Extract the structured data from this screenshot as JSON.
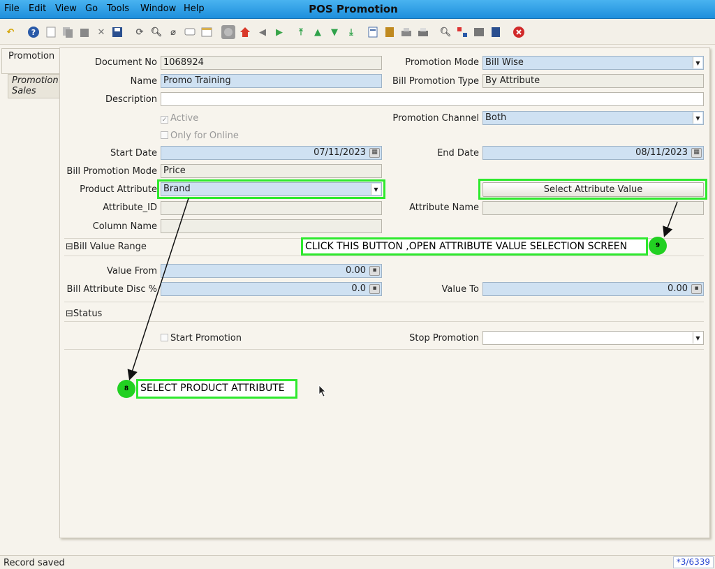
{
  "window": {
    "title": "POS Promotion"
  },
  "menu": [
    {
      "label": "File"
    },
    {
      "label": "Edit"
    },
    {
      "label": "View"
    },
    {
      "label": "Go"
    },
    {
      "label": "Tools"
    },
    {
      "label": "Window"
    },
    {
      "label": "Help"
    }
  ],
  "toolbar": {
    "icons": [
      "undo-icon",
      "help-icon",
      "new-record-icon",
      "copy-record-icon",
      "delete-icon",
      "delete-selection-icon",
      "save-icon",
      "refresh-icon",
      "find-icon",
      "attachment-icon",
      "chat-icon",
      "grid-toggle-icon",
      "history-icon",
      "home-icon",
      "back-icon",
      "forward-icon",
      "first-record-icon",
      "previous-record-icon",
      "next-record-icon",
      "last-record-icon",
      "report-icon",
      "archive-icon",
      "print-preview-icon",
      "print-icon",
      "zoom-across-icon",
      "workflow-icon",
      "product-info-icon",
      "end-icon",
      "close-icon"
    ]
  },
  "tabs": [
    {
      "label": "Promotion",
      "active": true
    },
    {
      "label": "Promotion Sales",
      "active": false
    }
  ],
  "form": {
    "document_no": {
      "label": "Document No",
      "value": "1068924"
    },
    "name": {
      "label": "Name",
      "value": "Promo Training"
    },
    "description": {
      "label": "Description",
      "value": ""
    },
    "active": {
      "label": "Active",
      "checked": true
    },
    "only_online": {
      "label": "Only for Online",
      "checked": false
    },
    "start_date": {
      "label": "Start Date",
      "value": "07/11/2023"
    },
    "bill_promotion_mode": {
      "label": "Bill Promotion Mode",
      "value": "Price"
    },
    "product_attribute": {
      "label": "Product Attribute",
      "value": "Brand"
    },
    "attribute_id": {
      "label": "Attribute_ID",
      "value": ""
    },
    "column_name": {
      "label": "Column Name",
      "value": ""
    },
    "promotion_mode": {
      "label": "Promotion Mode",
      "value": "Bill Wise"
    },
    "bill_promotion_type": {
      "label": "Bill Promotion Type",
      "value": "By Attribute"
    },
    "promotion_channel": {
      "label": "Promotion Channel",
      "value": "Both"
    },
    "end_date": {
      "label": "End Date",
      "value": "08/11/2023"
    },
    "select_attribute_button": {
      "label": "Select Attribute Value"
    },
    "attribute_name": {
      "label": "Attribute Name",
      "value": ""
    },
    "bill_value_range": {
      "title": "Bill Value Range"
    },
    "value_from": {
      "label": "Value From",
      "value": "0.00"
    },
    "bill_attr_disc": {
      "label": "Bill Attribute Disc %",
      "value": "0.0"
    },
    "value_to": {
      "label": "Value To",
      "value": "0.00"
    },
    "status": {
      "title": "Status"
    },
    "start_promotion": {
      "label": "Start Promotion",
      "checked": false
    },
    "stop_promotion": {
      "label": "Stop Promotion",
      "value": ""
    }
  },
  "annotations": {
    "callout_9": {
      "number": "9",
      "text": "CLICK THIS BUTTON ,OPEN ATTRIBUTE VALUE SELECTION SCREEN"
    },
    "callout_8": {
      "number": "8",
      "text": "SELECT PRODUCT ATTRIBUTE"
    },
    "color": "#2ee92e"
  },
  "status_bar": {
    "message": "Record saved",
    "record_count": "*3/6339"
  }
}
